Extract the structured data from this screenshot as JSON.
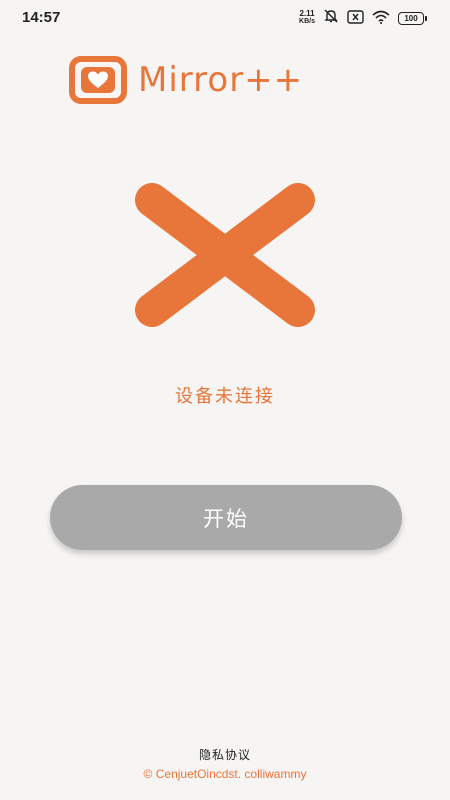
{
  "status_bar": {
    "time": "14:57",
    "net_speed_value": "2.11",
    "net_speed_unit": "KB/s",
    "battery": "100",
    "icons": [
      "mute-icon",
      "sim-off-icon",
      "wifi-icon",
      "battery-icon"
    ]
  },
  "app": {
    "name": "Mirror++",
    "accent_color": "#e8763a"
  },
  "connection": {
    "icon": "disconnected-x-icon",
    "status_text": "设备未连接"
  },
  "actions": {
    "start_label": "开始",
    "start_button_color": "#a9a9a9"
  },
  "footer": {
    "privacy_label": "隐私协议",
    "copyright": "© CenjuetOincdst. colliwammy"
  }
}
